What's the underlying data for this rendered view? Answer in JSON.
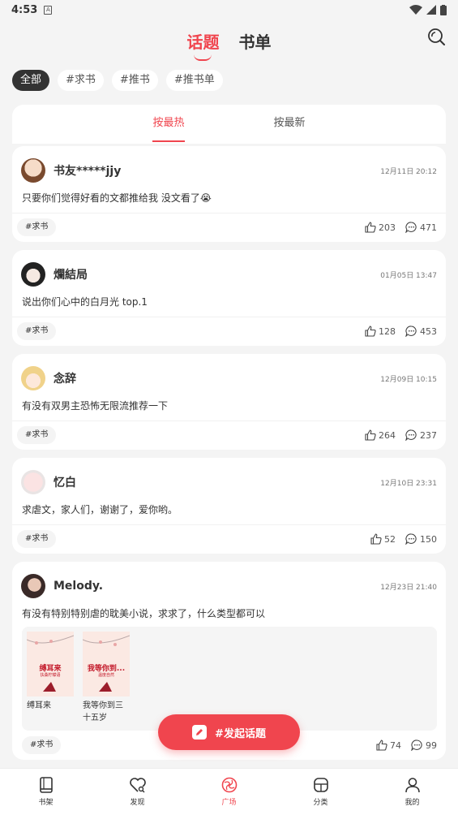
{
  "status_bar": {
    "time": "4:53",
    "sim_icon": "A"
  },
  "header": {
    "tabs": [
      {
        "label": "话题",
        "active": true
      },
      {
        "label": "书单",
        "active": false
      }
    ],
    "search_icon": "search-icon"
  },
  "filter_chips": [
    {
      "label": "全部",
      "active": true
    },
    {
      "label": "#求书",
      "active": false
    },
    {
      "label": "#推书",
      "active": false
    },
    {
      "label": "#推书单",
      "active": false
    }
  ],
  "sort_tabs": [
    {
      "label": "按最热",
      "active": true
    },
    {
      "label": "按最新",
      "active": false
    }
  ],
  "posts": [
    {
      "user": "书友*****jjy",
      "time": "12月11日 20:12",
      "text": "只要你们觉得好看的文都推给我 没文看了😭",
      "tag": "#求书",
      "likes": "203",
      "comments": "471"
    },
    {
      "user": "爛結局",
      "time": "01月05日 13:47",
      "text": "说出你们心中的白月光 top.1",
      "tag": "#求书",
      "likes": "128",
      "comments": "453"
    },
    {
      "user": "念辞",
      "time": "12月09日 10:15",
      "text": "有没有双男主恐怖无限流推荐一下",
      "tag": "#求书",
      "likes": "264",
      "comments": "237"
    },
    {
      "user": "忆白",
      "time": "12月10日 23:31",
      "text": "求虐文，家人们，谢谢了，爱你哟。",
      "tag": "#求书",
      "likes": "52",
      "comments": "150"
    },
    {
      "user": "Melody.",
      "time": "12月23日 21:40",
      "text": "有没有特别特别虐的耽美小说，求求了，什么类型都可以",
      "tag": "#求书",
      "likes": "74",
      "comments": "99",
      "books": [
        {
          "cover_title": "缚耳来",
          "cover_subtitle": "扶桑柠檬语",
          "name": "缚耳来"
        },
        {
          "cover_title": "我等你到...",
          "cover_subtitle": "温度自然",
          "name": "我等你到三十五岁"
        }
      ]
    }
  ],
  "fab": {
    "label": "#发起话题",
    "icon": "edit-icon"
  },
  "bottom_nav": [
    {
      "label": "书架",
      "icon": "book-icon",
      "active": false
    },
    {
      "label": "发现",
      "icon": "discover-icon",
      "active": false
    },
    {
      "label": "广场",
      "icon": "plaza-icon",
      "active": true
    },
    {
      "label": "分类",
      "icon": "category-icon",
      "active": false
    },
    {
      "label": "我的",
      "icon": "user-icon",
      "active": false
    }
  ],
  "colors": {
    "accent": "#f0454e",
    "background": "#f4f4f4",
    "chip_active": "#333333"
  }
}
